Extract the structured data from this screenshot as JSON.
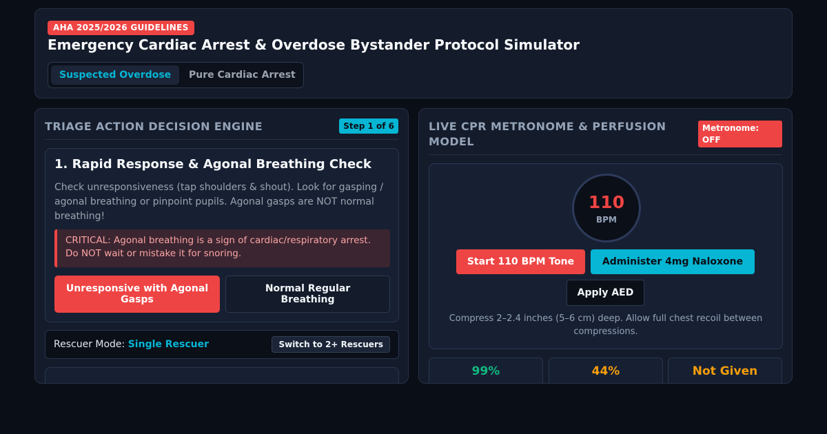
{
  "header": {
    "badge": "AHA 2025/2026 GUIDELINES",
    "title": "Emergency Cardiac Arrest & Overdose Bystander Protocol Simulator",
    "tabs": [
      {
        "label": "Suspected Overdose",
        "active": true
      },
      {
        "label": "Pure Cardiac Arrest",
        "active": false
      }
    ]
  },
  "triage": {
    "heading": "TRIAGE ACTION DECISION ENGINE",
    "step_badge": "Step 1 of 6",
    "step": {
      "title": "1. Rapid Response & Agonal Breathing Check",
      "description": "Check unresponsiveness (tap shoulders & shout). Look for gasping / agonal breathing or pinpoint pupils. Agonal gasps are NOT normal breathing!",
      "critical": "CRITICAL: Agonal breathing is a sign of cardiac/respiratory arrest. Do NOT wait or mistake it for snoring.",
      "choices": [
        {
          "label": "Unresponsive with Agonal Gasps"
        },
        {
          "label": "Normal Regular Breathing"
        }
      ]
    },
    "rescuer": {
      "label": "Rescuer Mode:",
      "value": "Single Rescuer",
      "switch_label": "Switch to 2+ Rescuers"
    }
  },
  "cpr": {
    "heading": "LIVE CPR METRONOME & PERFUSION MODEL",
    "metronome_badge": "Metronome: OFF",
    "bpm_value": "110",
    "bpm_unit": "BPM",
    "buttons": {
      "tone": "Start 110 BPM Tone",
      "naloxone": "Administer 4mg Naloxone",
      "aed": "Apply AED"
    },
    "note": "Compress 2–2.4 inches (5–6 cm) deep. Allow full chest recoil between compressions.",
    "stats": [
      {
        "value": "99%",
        "color": "#10b981"
      },
      {
        "value": "44%",
        "color": "#f59e0b"
      },
      {
        "value": "Not Given",
        "color": "#f59e0b"
      }
    ]
  },
  "colors": {
    "accent_red": "#ef4444",
    "accent_cyan": "#06b6d4",
    "background": "#0a0e16",
    "panel": "#141b2a"
  }
}
